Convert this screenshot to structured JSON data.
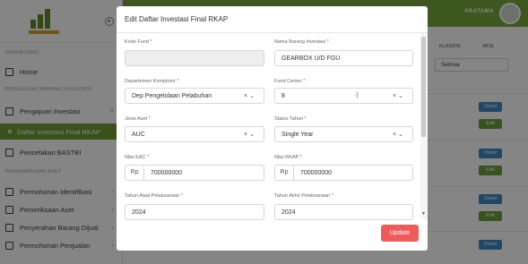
{
  "sidebar": {
    "sections": [
      {
        "header": "DASHBOARD",
        "items": [
          {
            "label": "Home",
            "icon": "home-icon"
          }
        ]
      },
      {
        "header": "PENGAJUAN BARANG INVESTASI",
        "items": [
          {
            "label": "Pengajuan Investasi",
            "icon": "calendar-icon"
          },
          {
            "label": "Daftar Investasi Final RKAP",
            "icon": "circle-icon",
            "active": true
          },
          {
            "label": "Pencetakan BASTBI",
            "icon": "document-icon"
          }
        ]
      },
      {
        "header": "PENGHAPUSAN ASET",
        "items": [
          {
            "label": "Permohonan Identifikasi",
            "icon": "user-icon"
          },
          {
            "label": "Pemeriksaan Aset",
            "icon": "clipboard-icon"
          },
          {
            "label": "Penyerahan Barang Dijual",
            "icon": "box-icon"
          },
          {
            "label": "Permohonan Penjualan",
            "icon": "tag-icon"
          }
        ]
      }
    ]
  },
  "topbar": {
    "brand": "PRATAMA"
  },
  "table": {
    "headers": [
      "KLASIFIK",
      "AKSI"
    ],
    "filter_value": "Semua",
    "detail_label": "Detail",
    "edit_label": "Edit"
  },
  "modal": {
    "title": "Edit Daftar Investasi Final RKAP",
    "close_glyph": "×",
    "fields": {
      "kode_fund": {
        "label": "Kode Fund",
        "value": ""
      },
      "nama_barang": {
        "label": "Nama Barang Investasi",
        "value": "GEARBOX U/D FGU"
      },
      "departemen": {
        "label": "Departemen Komplotor",
        "value": "Dep Pengelolaan Pelabuhan"
      },
      "fund_center": {
        "label": "Fund Center",
        "value": "8",
        "value_suffix": "\u0000"
      },
      "jenis_aset": {
        "label": "Jenis Aset",
        "value": "AUC"
      },
      "status_tahun": {
        "label": "Status Tahun",
        "value": "Single Year"
      },
      "nilai_eac": {
        "label": "Nilai EAC",
        "prefix": "Rp",
        "value": "700000000"
      },
      "nilai_rkap": {
        "label": "Nilai RKAP",
        "prefix": "Rp",
        "value": "700000000"
      },
      "tahun_awal": {
        "label": "Tahun Awal Pelaksanaan",
        "value": "2024"
      },
      "tahun_akhir": {
        "label": "Tahun Akhir Pelaksanaan",
        "value": "2024"
      }
    },
    "required_mark": "*",
    "select_controls": "× ⌄",
    "update_label": "Update"
  }
}
